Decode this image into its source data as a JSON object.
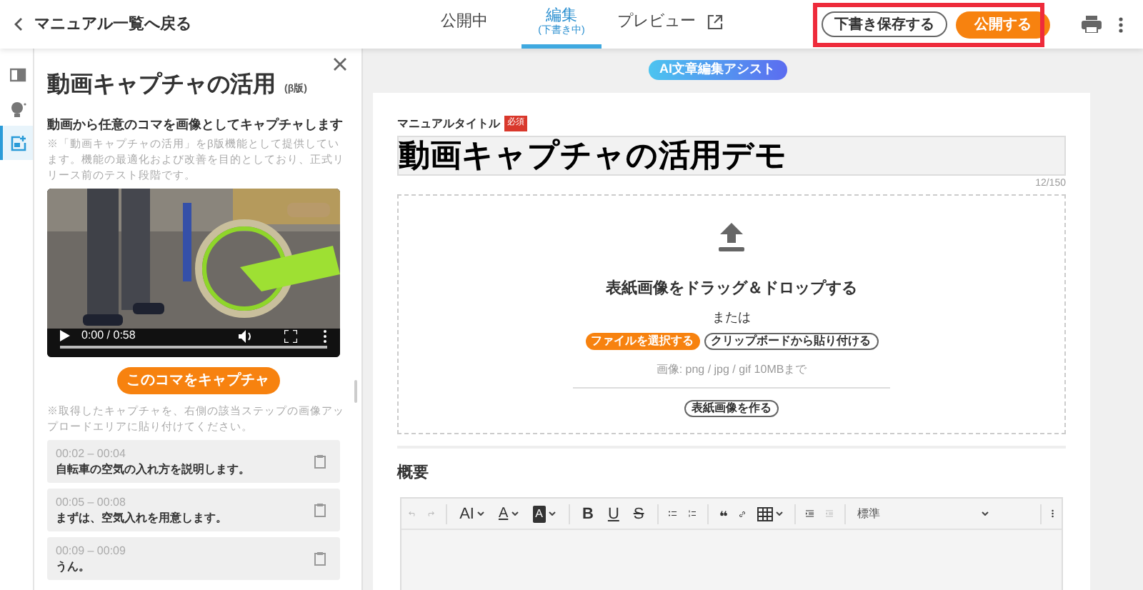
{
  "header": {
    "back_label": "マニュアル一覧へ戻る",
    "tabs": [
      {
        "label": "公開中",
        "selected": false
      },
      {
        "label": "編集",
        "sublabel": "(下書き中)",
        "selected": true
      },
      {
        "label": "プレビュー",
        "external": true,
        "selected": false
      }
    ],
    "save_draft": "下書き保存する",
    "publish": "公開する",
    "actions_highlighted": true
  },
  "rail": [
    {
      "kind": "book",
      "selected": false
    },
    {
      "kind": "bulb",
      "selected": false
    },
    {
      "kind": "capture",
      "selected": true
    }
  ],
  "panel": {
    "title": "動画キャプチャの活用",
    "badge": "(β版)",
    "subtitle": "動画から任意のコマを画像としてキャプチャします",
    "note": "※「動画キャプチャの活用」をβ版機能として提供しています。機能の最適化および改善を目的としており、正式リリース前のテスト段階です。",
    "video": {
      "kind": "picture",
      "time": "0:00 / 0:58"
    },
    "capture_button": "このコマをキャプチャ",
    "hint": "※取得したキャプチャを、右側の該当ステップの画像アップロードエリアに貼り付けてください。",
    "segments": [
      {
        "time": "00:02 – 00:04",
        "text": "自転車の空気の入れ方を説明します。"
      },
      {
        "time": "00:05 – 00:08",
        "text": "まずは、空気入れを用意します。"
      },
      {
        "time": "00:09 – 00:09",
        "text": "うん。"
      }
    ]
  },
  "editor": {
    "assist_button": "AI文章編集アシスト",
    "title_label": "マニュアルタイトル",
    "required_badge": "必須",
    "title_value": "動画キャプチャの活用デモ",
    "counter": "12/150",
    "upload": {
      "heading": "表紙画像をドラッグ＆ドロップする",
      "or": "または",
      "select_file": "ファイルを選択する",
      "paste": "クリップボードから貼り付ける",
      "formats": "画像: png / jpg / gif 10MBまで",
      "make_cover": "表紙画像を作る"
    },
    "summary_label": "概要",
    "toolbar": [
      {
        "kind": "undo",
        "disabled": true
      },
      {
        "kind": "redo",
        "disabled": true
      },
      {
        "kind": "sep"
      },
      {
        "kind": "font-size",
        "label": "AI",
        "disabled": false
      },
      {
        "kind": "font-color",
        "label": "A",
        "disabled": false
      },
      {
        "kind": "highlight",
        "label": "A",
        "disabled": false
      },
      {
        "kind": "sep"
      },
      {
        "kind": "bold",
        "label": "B",
        "disabled": false
      },
      {
        "kind": "underline",
        "label": "U",
        "disabled": false
      },
      {
        "kind": "strike",
        "label": "S",
        "disabled": false
      },
      {
        "kind": "sep"
      },
      {
        "kind": "bullets",
        "disabled": false
      },
      {
        "kind": "numbers",
        "disabled": false
      },
      {
        "kind": "sep"
      },
      {
        "kind": "quote",
        "disabled": false
      },
      {
        "kind": "link",
        "disabled": false
      },
      {
        "kind": "table",
        "disabled": false
      },
      {
        "kind": "sep"
      },
      {
        "kind": "indent",
        "disabled": false
      },
      {
        "kind": "outdent",
        "disabled": true
      },
      {
        "kind": "sep"
      },
      {
        "kind": "select",
        "label": "標準"
      },
      {
        "kind": "sep"
      },
      {
        "kind": "more",
        "disabled": false
      }
    ]
  }
}
